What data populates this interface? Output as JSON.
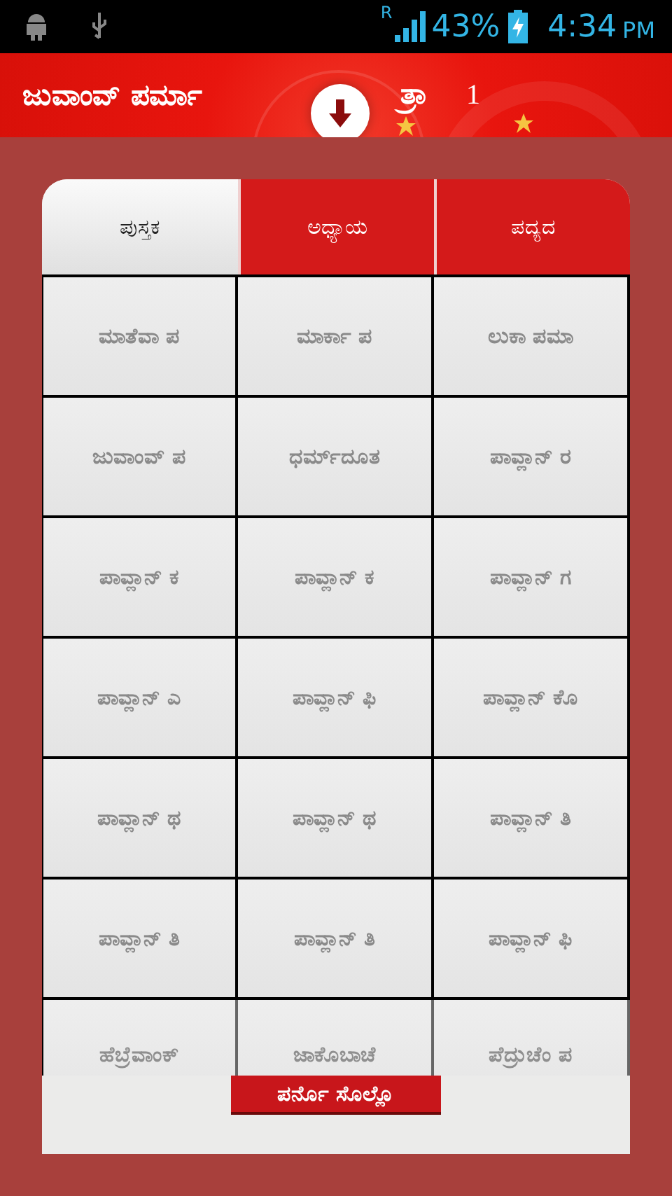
{
  "status_bar": {
    "network": "R",
    "battery": "43%",
    "time": "4:34",
    "ampm": "PM"
  },
  "header": {
    "title": "ಜುವಾಂವ್ ಪರ್ಮಾ",
    "title_tail": "ತ್ರಾ",
    "chapter": "1"
  },
  "dialog": {
    "tabs": [
      {
        "label": "ಪುಸ್ತಕ",
        "selected": true
      },
      {
        "label": "ಅಧ್ಯಾಯ",
        "selected": false
      },
      {
        "label": "ಪದ್ಯದ",
        "selected": false
      }
    ],
    "rows": [
      {
        "faded": false,
        "cells": [
          "ಮಾತೆವಾ ಪ",
          "ಮಾರ್ಕಾ ಪ",
          "ಲುಕಾ ಪಮಾ"
        ]
      },
      {
        "faded": false,
        "cells": [
          "ಜುವಾಂವ್ ಪ",
          "ಧರ್ಮ್‌ದೂತ",
          "ಪಾವ್ಲಾನ್ ರ"
        ]
      },
      {
        "faded": false,
        "cells": [
          "ಪಾವ್ಲಾನ್ ಕ",
          "ಪಾವ್ಲಾನ್ ಕ",
          "ಪಾವ್ಲಾನ್ ಗ"
        ]
      },
      {
        "faded": false,
        "cells": [
          "ಪಾವ್ಲಾನ್ ಎ",
          "ಪಾವ್ಲಾನ್ ಫಿ",
          "ಪಾವ್ಲಾನ್ ಕೊ"
        ]
      },
      {
        "faded": false,
        "cells": [
          "ಪಾವ್ಲಾನ್ ಥ",
          "ಪಾವ್ಲಾನ್ ಥ",
          "ಪಾವ್ಲಾನ್ ತಿ"
        ]
      },
      {
        "faded": false,
        "cells": [
          "ಪಾವ್ಲಾನ್ ತಿ",
          "ಪಾವ್ಲಾನ್ ತಿ",
          "ಪಾವ್ಲಾನ್ ಫಿ"
        ]
      },
      {
        "faded": true,
        "cells": [
          "ಹೆಬ್ರೆವಾಂಕ್",
          "ಜಾಕೊಬಾಚೆ",
          "ಪೆದ್ರುಚೆಂ ಪ"
        ]
      }
    ],
    "button": "ಪರ್ನೊ ಸೊಲ್ಲೊ"
  }
}
